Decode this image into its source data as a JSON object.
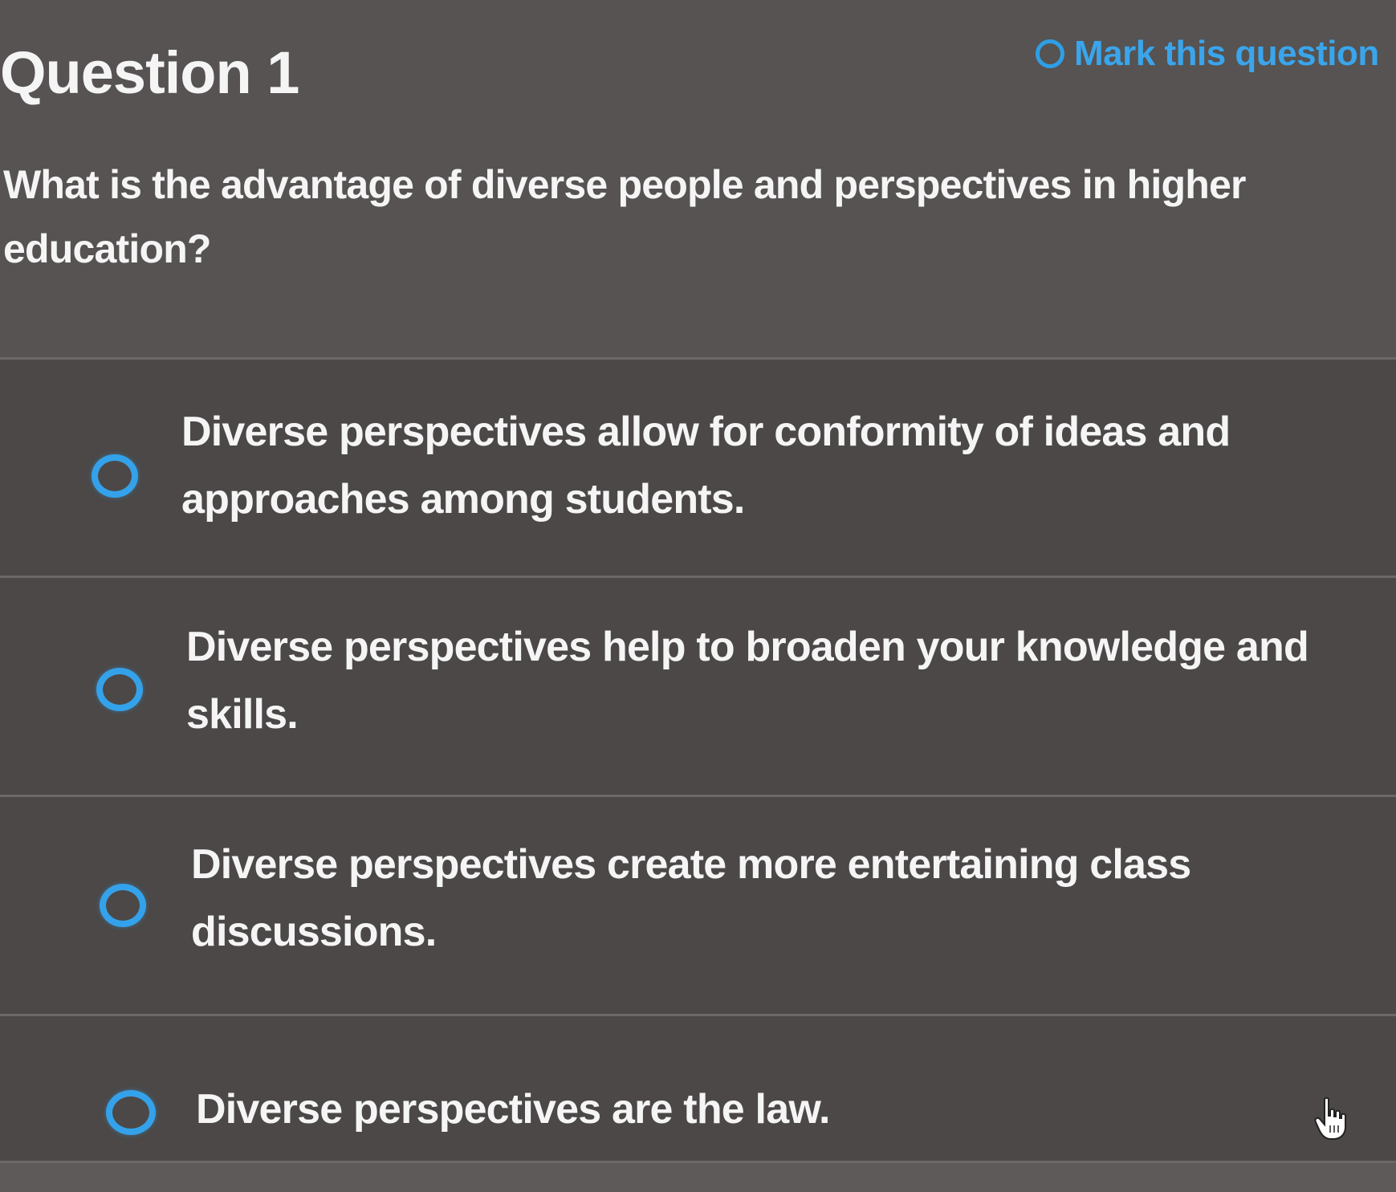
{
  "question": {
    "title": "Question 1",
    "mark_label": "Mark this question",
    "text": "What is the advantage of diverse people and perspectives in higher education?"
  },
  "answers": [
    {
      "label": "Diverse perspectives allow for conformity of ideas and approaches among students."
    },
    {
      "label": "Diverse perspectives help to broaden your knowledge and skills."
    },
    {
      "label": "Diverse perspectives create more entertaining class discussions."
    },
    {
      "label": "Diverse perspectives are the law."
    }
  ],
  "colors": {
    "accent": "#34a2ea",
    "background": "#4b4847",
    "header_background": "#565352",
    "text": "#f5f5f5"
  },
  "icons": {
    "mark": "radio-circle-icon",
    "answer": "radio-circle-icon",
    "cursor": "hand-pointer-icon"
  }
}
